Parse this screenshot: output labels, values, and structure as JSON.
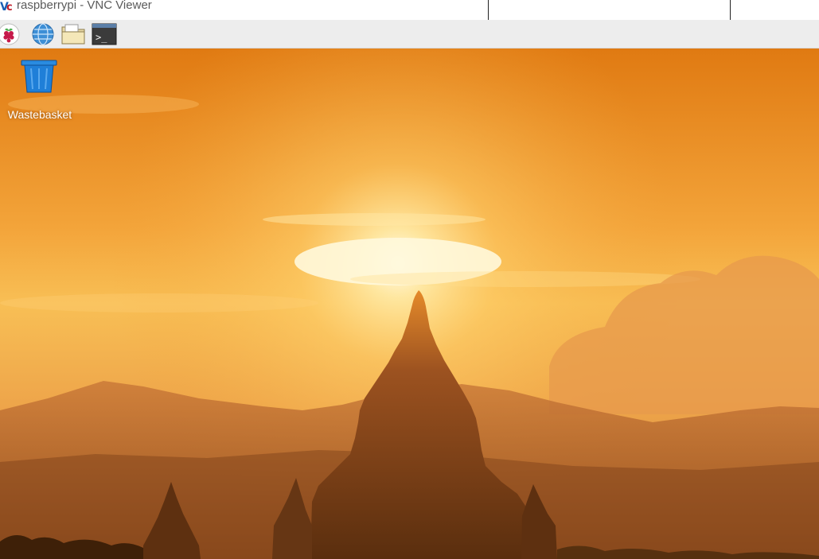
{
  "window": {
    "title": "raspberrypi - VNC Viewer",
    "app_icon": "vnc-icon"
  },
  "taskbar": {
    "items": [
      {
        "name": "menu",
        "icon": "raspberry-pi-icon"
      },
      {
        "name": "web-browser",
        "icon": "globe-icon"
      },
      {
        "name": "file-manager",
        "icon": "folder-icon"
      },
      {
        "name": "terminal",
        "icon": "terminal-icon",
        "glyph": ">_"
      }
    ]
  },
  "desktop": {
    "icons": [
      {
        "label": "Wastebasket",
        "icon": "wastebasket-icon"
      }
    ],
    "wallpaper": "sunset-temple-silhouette"
  },
  "colors": {
    "taskbar_bg": "#ededed",
    "sky_top": "#e07a12",
    "sky_mid": "#f6b84a",
    "sun": "#fff6d6",
    "silhouette": "#5a2e0e",
    "trash_blue": "#1f7fd8"
  }
}
